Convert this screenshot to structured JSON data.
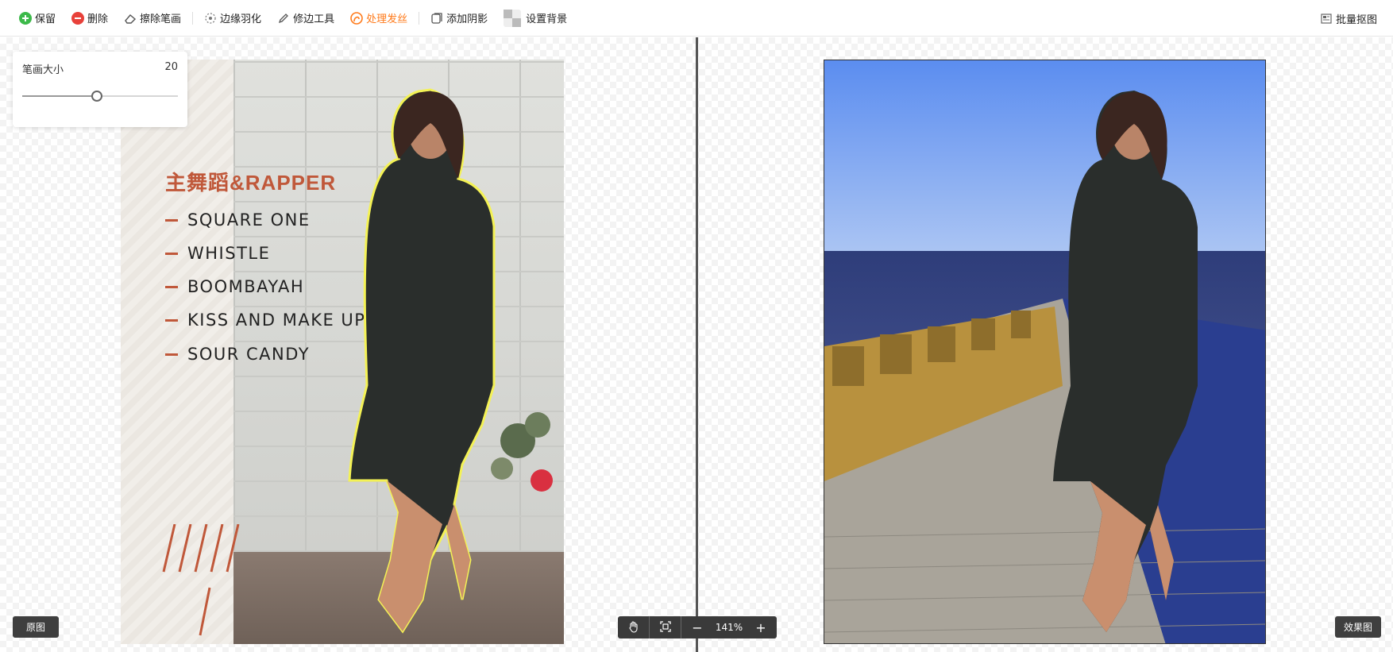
{
  "toolbar": {
    "items": [
      {
        "label": "保留",
        "icon": "plus-circle-icon",
        "color": "#3cb94a"
      },
      {
        "label": "删除",
        "icon": "minus-circle-icon",
        "color": "#e8413a"
      },
      {
        "label": "擦除笔画",
        "icon": "eraser-icon"
      },
      {
        "label": "边缘羽化",
        "icon": "feather-icon"
      },
      {
        "label": "修边工具",
        "icon": "pen-icon"
      },
      {
        "label": "处理发丝",
        "icon": "hair-icon",
        "active": true,
        "color": "#ff7a1a"
      },
      {
        "label": "添加阴影",
        "icon": "shadow-icon"
      },
      {
        "label": "设置背景",
        "icon": "checker-icon"
      }
    ],
    "batch_label": "批量抠图"
  },
  "brush": {
    "label": "笔画大小",
    "value": "20",
    "level": 0.48
  },
  "poster": {
    "title": "主舞蹈&RAPPER",
    "songs": [
      "SQUARE ONE",
      "WHISTLE",
      "BOOMBAYAH",
      "KISS AND MAKE UP",
      "SOUR CANDY"
    ],
    "accent": "#c0583a"
  },
  "bottom": {
    "original_label": "原图",
    "result_label": "效果图",
    "zoom": "141%",
    "zoom_out": "−",
    "zoom_in": "+"
  }
}
